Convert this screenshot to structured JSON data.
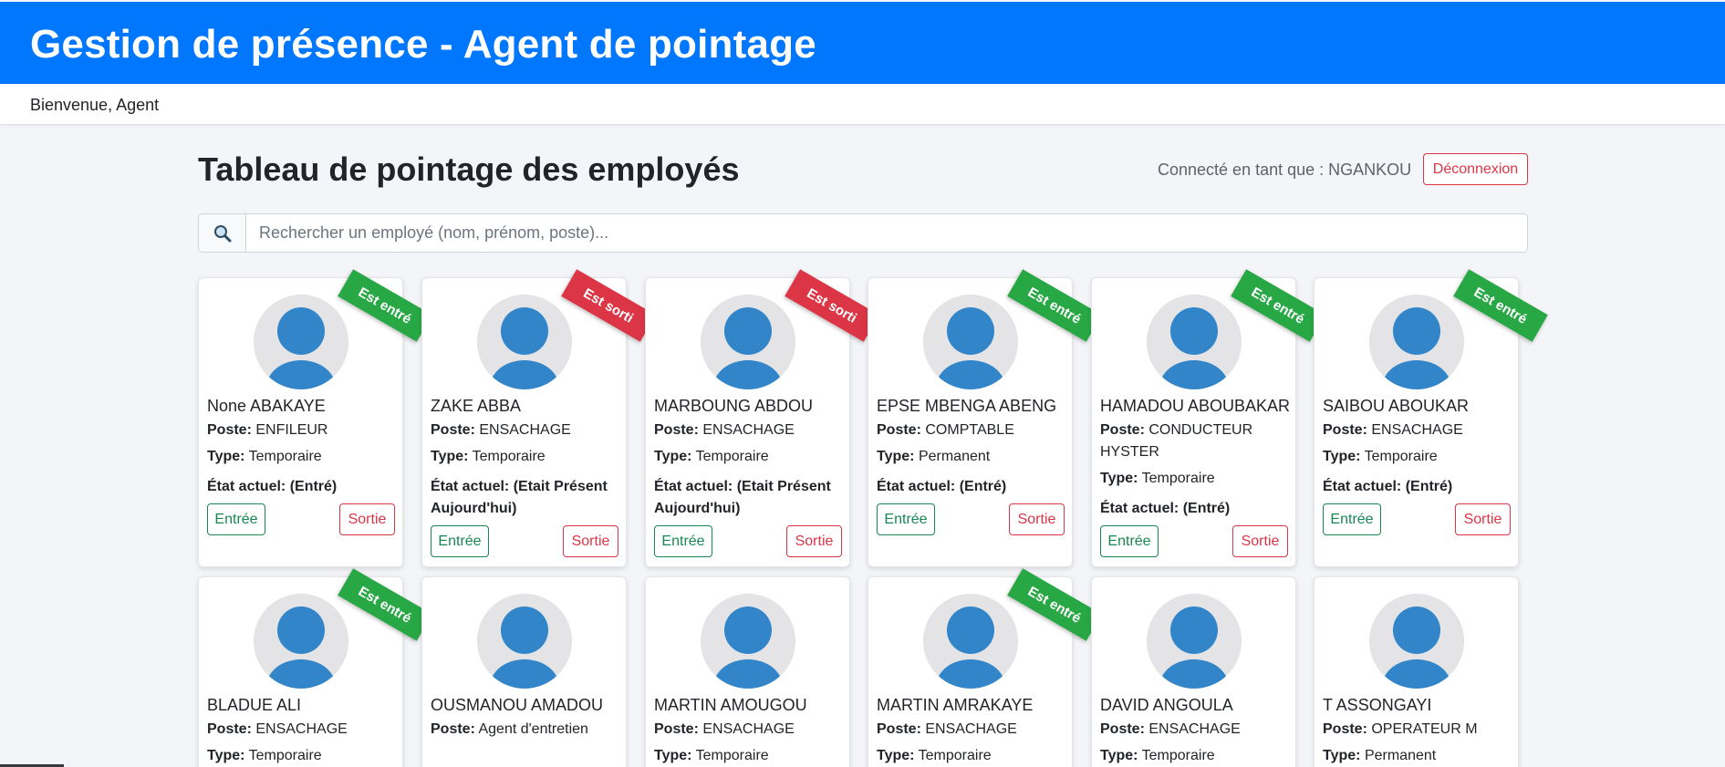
{
  "header": {
    "title": "Gestion de présence - Agent de pointage"
  },
  "welcome": {
    "text": "Bienvenue, Agent"
  },
  "page": {
    "title": "Tableau de pointage des employés",
    "connected_label": "Connecté en tant que : NGANKOU",
    "logout_label": "Déconnexion"
  },
  "search": {
    "icon": "search-icon",
    "placeholder": "Rechercher un employé (nom, prénom, poste)..."
  },
  "labels": {
    "poste": "Poste:",
    "type": "Type:",
    "etat": "État actuel:",
    "entree": "Entrée",
    "sortie": "Sortie"
  },
  "colors": {
    "primary": "#0077fc",
    "success": "#28a745",
    "danger": "#dc3545",
    "avatar": "#3185c8"
  },
  "employees": [
    {
      "name": "None ABAKAYE",
      "poste": "ENFILEUR",
      "type": "Temporaire",
      "etat": "(Entré)",
      "badge": "Est entré",
      "status": "in"
    },
    {
      "name": "ZAKE ABBA",
      "poste": "ENSACHAGE",
      "type": "Temporaire",
      "etat": "(Etait Présent Aujourd'hui)",
      "badge": "Est sorti",
      "status": "out"
    },
    {
      "name": "MARBOUNG ABDOU",
      "poste": "ENSACHAGE",
      "type": "Temporaire",
      "etat": "(Etait Présent Aujourd'hui)",
      "badge": "Est sorti",
      "status": "out"
    },
    {
      "name": "EPSE MBENGA ABENG",
      "poste": "COMPTABLE",
      "type": "Permanent",
      "etat": "(Entré)",
      "badge": "Est entré",
      "status": "in"
    },
    {
      "name": "HAMADOU ABOUBAKAR",
      "poste": "CONDUCTEUR HYSTER",
      "type": "Temporaire",
      "etat": "(Entré)",
      "badge": "Est entré",
      "status": "in"
    },
    {
      "name": "SAIBOU ABOUKAR",
      "poste": "ENSACHAGE",
      "type": "Temporaire",
      "etat": "(Entré)",
      "badge": "Est entré",
      "status": "in"
    },
    {
      "name": "BLADUE ALI",
      "poste": "ENSACHAGE",
      "type": "Temporaire",
      "badge": "Est entré",
      "status": "in"
    },
    {
      "name": "OUSMANOU AMADOU",
      "poste": "Agent d'entretien",
      "type": "Temporaire",
      "badge": null,
      "status": "none"
    },
    {
      "name": "MARTIN AMOUGOU",
      "poste": "ENSACHAGE",
      "type": "Temporaire",
      "badge": null,
      "status": "none"
    },
    {
      "name": "MARTIN AMRAKAYE",
      "poste": "ENSACHAGE",
      "type": "Temporaire",
      "badge": "Est entré",
      "status": "in"
    },
    {
      "name": "DAVID ANGOULA",
      "poste": "ENSACHAGE",
      "type": "Temporaire",
      "badge": null,
      "status": "none"
    },
    {
      "name": "T ASSONGAYI",
      "poste": "OPERATEUR M",
      "type": "Permanent",
      "badge": null,
      "status": "none"
    }
  ]
}
